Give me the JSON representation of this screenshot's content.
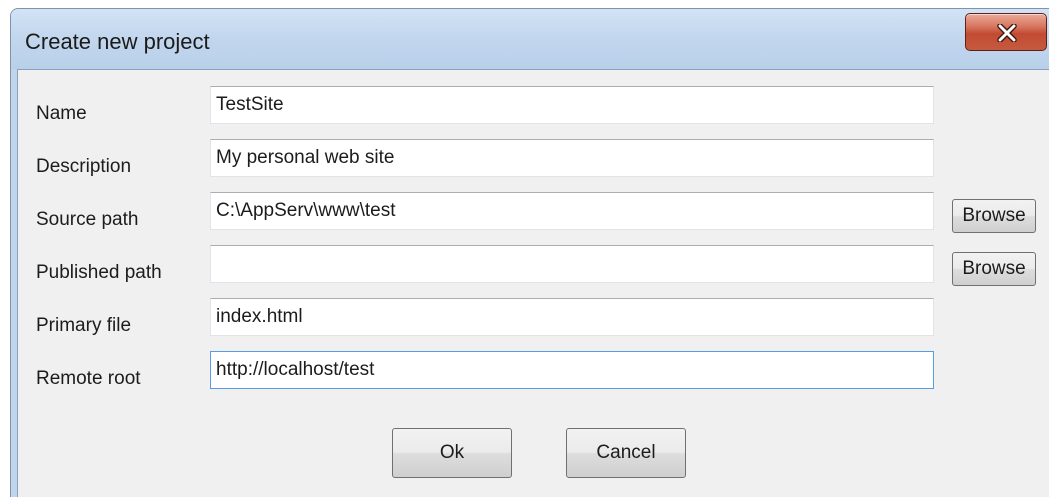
{
  "window": {
    "title": "Create new project",
    "close_icon": "close-x-icon"
  },
  "form": {
    "fields": [
      {
        "label": "Name",
        "value": "TestSite"
      },
      {
        "label": "Description",
        "value": "My personal web site"
      },
      {
        "label": "Source path",
        "value": "C:\\AppServ\\www\\test"
      },
      {
        "label": "Published path",
        "value": ""
      },
      {
        "label": "Primary file",
        "value": "index.html"
      },
      {
        "label": "Remote root",
        "value": "http://localhost/test"
      }
    ],
    "browse_label": "Browse"
  },
  "actions": {
    "ok_label": "Ok",
    "cancel_label": "Cancel"
  },
  "colors": {
    "titlebar": "#c3d7ee",
    "close_button": "#c24b32",
    "client_background": "#f0f0f0",
    "focus_border": "#569de5"
  }
}
